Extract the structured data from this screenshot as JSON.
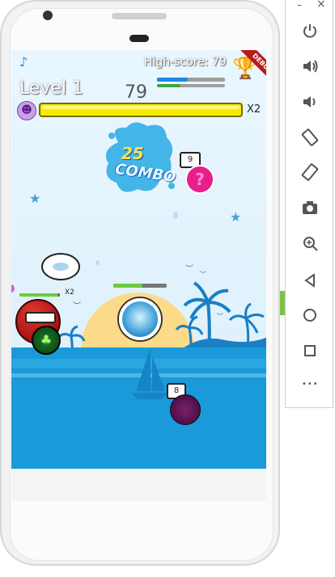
{
  "hud": {
    "high_score": "High-score: 79",
    "level": "Level 1",
    "score": "79",
    "multiplier": "X2",
    "debug_banner": "DEBUG",
    "main_bar_progress": 1.0,
    "xp_bar_blue_progress": 0.45,
    "xp_bar_green_progress": 0.35
  },
  "combo": {
    "count": "25",
    "label": "COMBO"
  },
  "enemies": {
    "pink_bubble_count": "9",
    "dark_ball_count": "8",
    "red_enemy_multiplier": "X2",
    "red_enemy_health": 0.95,
    "player_health": 0.55
  },
  "colors": {
    "sky": "#e9f6ff",
    "sea": "#1a9ad8",
    "sun": "#fbdb8a",
    "pink": "#e91e8c",
    "yellow_bar": "#f5ec00"
  },
  "emulator_toolbar": {
    "minimize": "–",
    "close": "×",
    "more": "•••"
  }
}
